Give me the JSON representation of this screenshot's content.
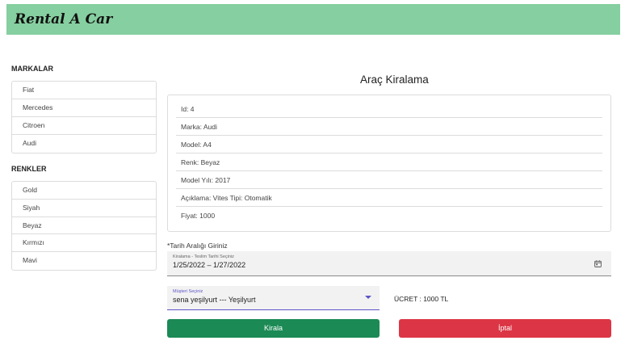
{
  "navbar": {
    "brand": "Rental A Car"
  },
  "sidebar": {
    "brands_title": "MARKALAR",
    "brands": [
      "Fiat",
      "Mercedes",
      "Citroen",
      "Audi"
    ],
    "colors_title": "RENKLER",
    "colors": [
      "Gold",
      "Siyah",
      "Beyaz",
      "Kırmızı",
      "Mavi"
    ]
  },
  "main": {
    "title": "Araç Kiralama",
    "details": [
      "Id: 4",
      "Marka: Audi",
      "Model: A4",
      "Renk: Beyaz",
      "Model Yılı: 2017",
      "Açıklama: Vites Tipi: Otomatik",
      "Fiyat: 1000"
    ],
    "date_section_label": "*Tarih Aralığı Giriniz",
    "date_field": {
      "caption": "Kiralama - Teslim Tarihi Seçiniz",
      "value": "1/25/2022 – 1/27/2022"
    },
    "customer_field": {
      "caption": "Müşteri Seçiniz",
      "value": "sena yeşilyurt --- Yeşilyurt"
    },
    "fee": "ÜCRET : 1000 TL",
    "rent_button": "Kirala",
    "cancel_button": "İptal"
  },
  "colors": {
    "navbar": "#86cfa0",
    "rent_button": "#1b8a55",
    "cancel_button": "#dc3545",
    "accent": "#5c54c7"
  }
}
